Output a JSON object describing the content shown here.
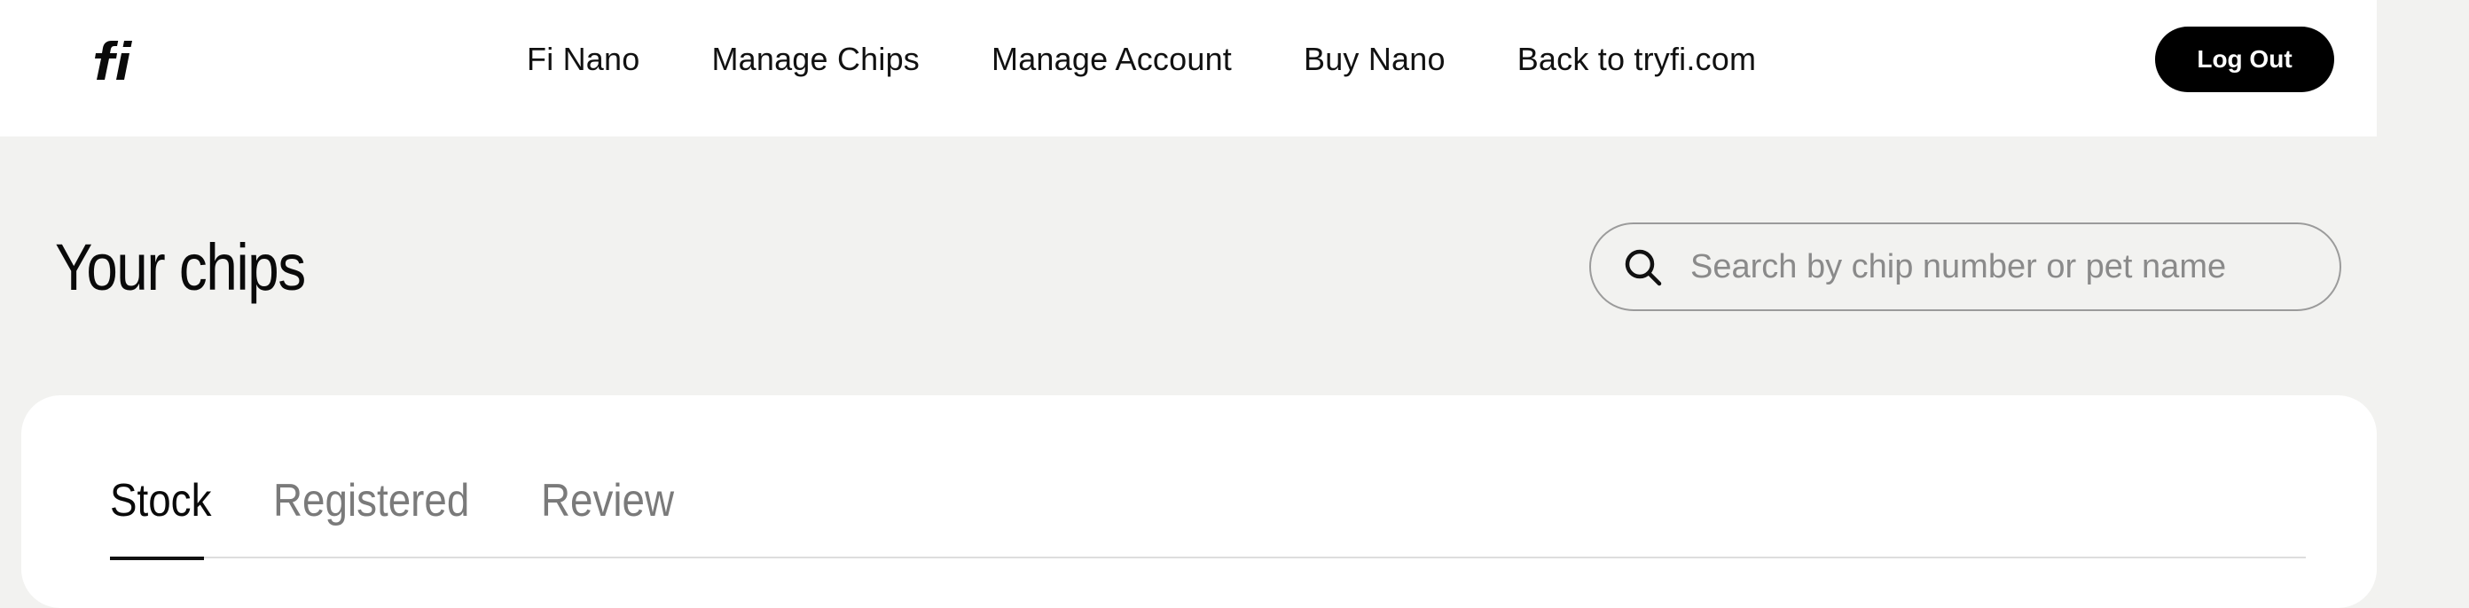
{
  "header": {
    "logo_alt": "fi",
    "nav": [
      {
        "label": "Fi Nano"
      },
      {
        "label": "Manage Chips"
      },
      {
        "label": "Manage Account"
      },
      {
        "label": "Buy Nano"
      },
      {
        "label": "Back to tryfi.com"
      }
    ],
    "logout_label": "Log Out"
  },
  "page": {
    "title": "Your chips"
  },
  "search": {
    "placeholder": "Search by chip number or pet name",
    "value": ""
  },
  "tabs": [
    {
      "label": "Stock",
      "active": true
    },
    {
      "label": "Registered",
      "active": false
    },
    {
      "label": "Review",
      "active": false
    }
  ],
  "colors": {
    "page_background": "#f2f2f0",
    "header_background": "#ffffff",
    "button_background": "#000000",
    "button_text": "#ffffff",
    "inactive_tab": "#7a7a7a"
  },
  "icons": {
    "logo": "fi-logo",
    "search": "search-icon"
  }
}
